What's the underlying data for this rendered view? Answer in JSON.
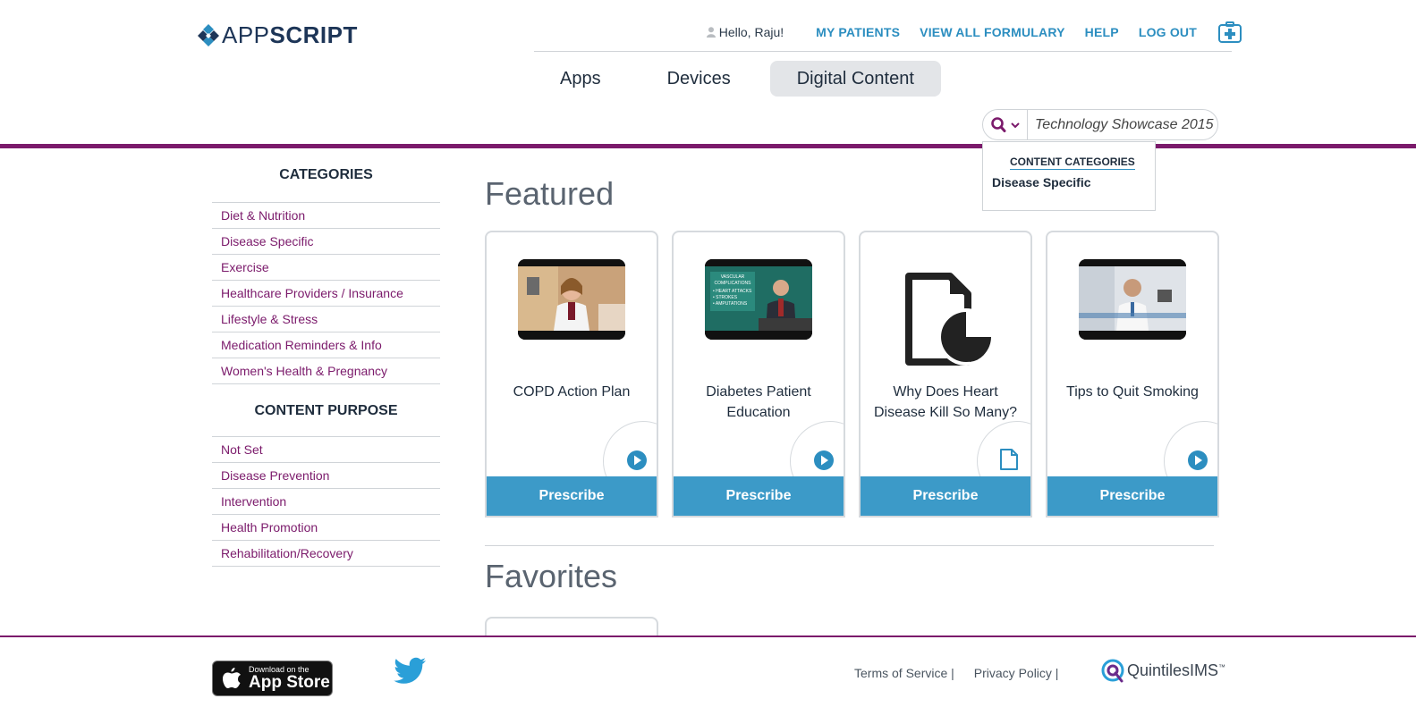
{
  "brand": {
    "app": "APP",
    "script": "SCRIPT"
  },
  "topnav": {
    "greeting": "Hello, Raju!",
    "links": [
      "MY PATIENTS",
      "VIEW ALL FORMULARY",
      "HELP",
      "LOG OUT"
    ]
  },
  "tabs": [
    "Apps",
    "Devices",
    "Digital Content"
  ],
  "search": {
    "value": "Technology Showcase 2015"
  },
  "dropdown": {
    "title": "CONTENT CATEGORIES",
    "item": "Disease Specific"
  },
  "sidebar": {
    "categories_title": "CATEGORIES",
    "categories": [
      "Diet & Nutrition",
      "Disease Specific",
      "Exercise",
      "Healthcare Providers / Insurance",
      "Lifestyle & Stress",
      "Medication Reminders & Info",
      "Women's Health & Pregnancy"
    ],
    "purpose_title": "CONTENT PURPOSE",
    "purposes": [
      "Not Set",
      "Disease Prevention",
      "Intervention",
      "Health Promotion",
      "Rehabilitation/Recovery"
    ]
  },
  "main": {
    "featured_title": "Featured",
    "favorites_title": "Favorites",
    "cards": [
      {
        "title": "COPD Action Plan",
        "type": "video",
        "button": "Prescribe"
      },
      {
        "title": "Diabetes Patient Education",
        "type": "video",
        "button": "Prescribe",
        "thumb_lines": [
          "VASCULAR",
          "COMPLICATIONS",
          "• HEART ATTACKS",
          "• STROKES",
          "• AMPUTATIONS"
        ]
      },
      {
        "title": "Why Does Heart Disease Kill So Many?",
        "type": "document",
        "button": "Prescribe"
      },
      {
        "title": "Tips to Quit Smoking",
        "type": "video",
        "button": "Prescribe"
      }
    ]
  },
  "footer": {
    "appstore_small": "Download on the",
    "appstore_big": "App Store",
    "links": [
      "Terms of Service |",
      "Privacy Policy |"
    ],
    "partner": "QuintilesIMS",
    "partner_tm": "™"
  },
  "colors": {
    "brand_purple": "#7b1a6b",
    "link_blue": "#2c8ec0",
    "button_blue": "#3c9ac8",
    "text_dark": "#1f2d3d"
  }
}
